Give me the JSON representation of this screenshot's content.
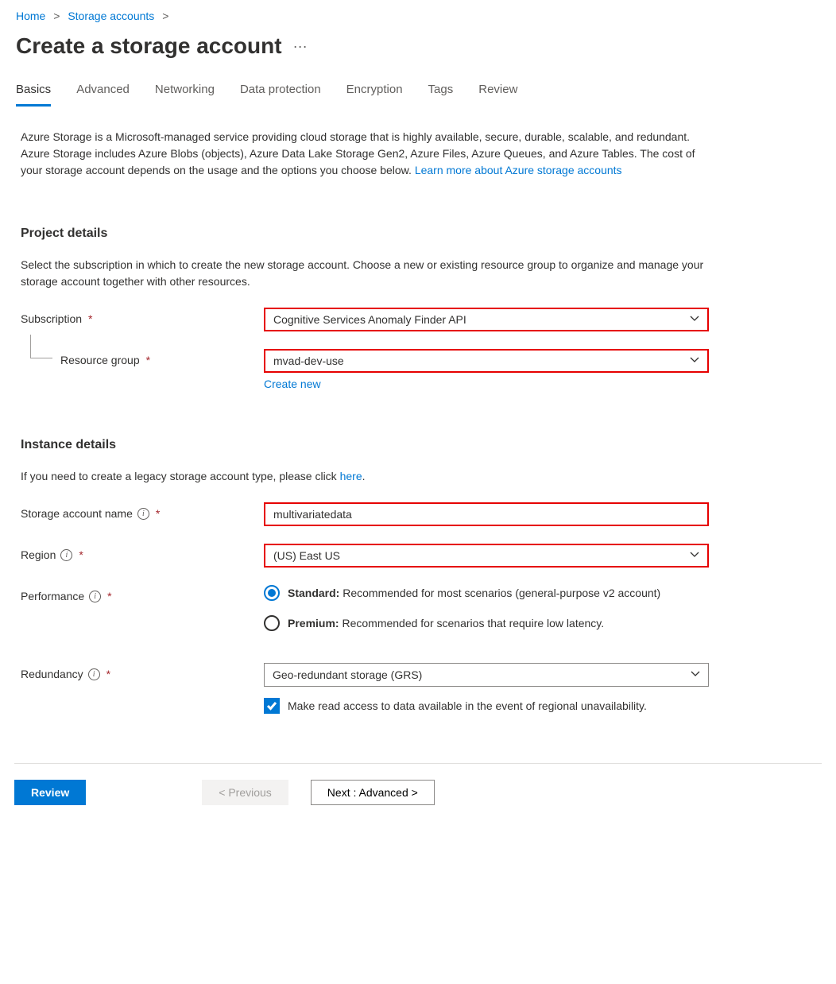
{
  "breadcrumb": {
    "home": "Home",
    "storage": "Storage accounts"
  },
  "page_title": "Create a storage account",
  "tabs": [
    "Basics",
    "Advanced",
    "Networking",
    "Data protection",
    "Encryption",
    "Tags",
    "Review"
  ],
  "active_tab": "Basics",
  "intro": {
    "text": "Azure Storage is a Microsoft-managed service providing cloud storage that is highly available, secure, durable, scalable, and redundant. Azure Storage includes Azure Blobs (objects), Azure Data Lake Storage Gen2, Azure Files, Azure Queues, and Azure Tables. The cost of your storage account depends on the usage and the options you choose below. ",
    "link": "Learn more about Azure storage accounts"
  },
  "project": {
    "header": "Project details",
    "desc": "Select the subscription in which to create the new storage account. Choose a new or existing resource group to organize and manage your storage account together with other resources.",
    "subscription_label": "Subscription",
    "subscription_value": "Cognitive Services Anomaly Finder API",
    "rg_label": "Resource group",
    "rg_value": "mvad-dev-use",
    "create_new": "Create new"
  },
  "instance": {
    "header": "Instance details",
    "desc_prefix": "If you need to create a legacy storage account type, please click ",
    "desc_link": "here",
    "desc_suffix": ".",
    "name_label": "Storage account name",
    "name_value": "multivariatedata",
    "region_label": "Region",
    "region_value": "(US) East US",
    "performance_label": "Performance",
    "perf_standard_bold": "Standard:",
    "perf_standard_text": " Recommended for most scenarios (general-purpose v2 account)",
    "perf_premium_bold": "Premium:",
    "perf_premium_text": " Recommended for scenarios that require low latency.",
    "redundancy_label": "Redundancy",
    "redundancy_value": "Geo-redundant storage (GRS)",
    "read_access_label": "Make read access to data available in the event of regional unavailability."
  },
  "footer": {
    "review": "Review",
    "previous": "< Previous",
    "next": "Next : Advanced >"
  }
}
